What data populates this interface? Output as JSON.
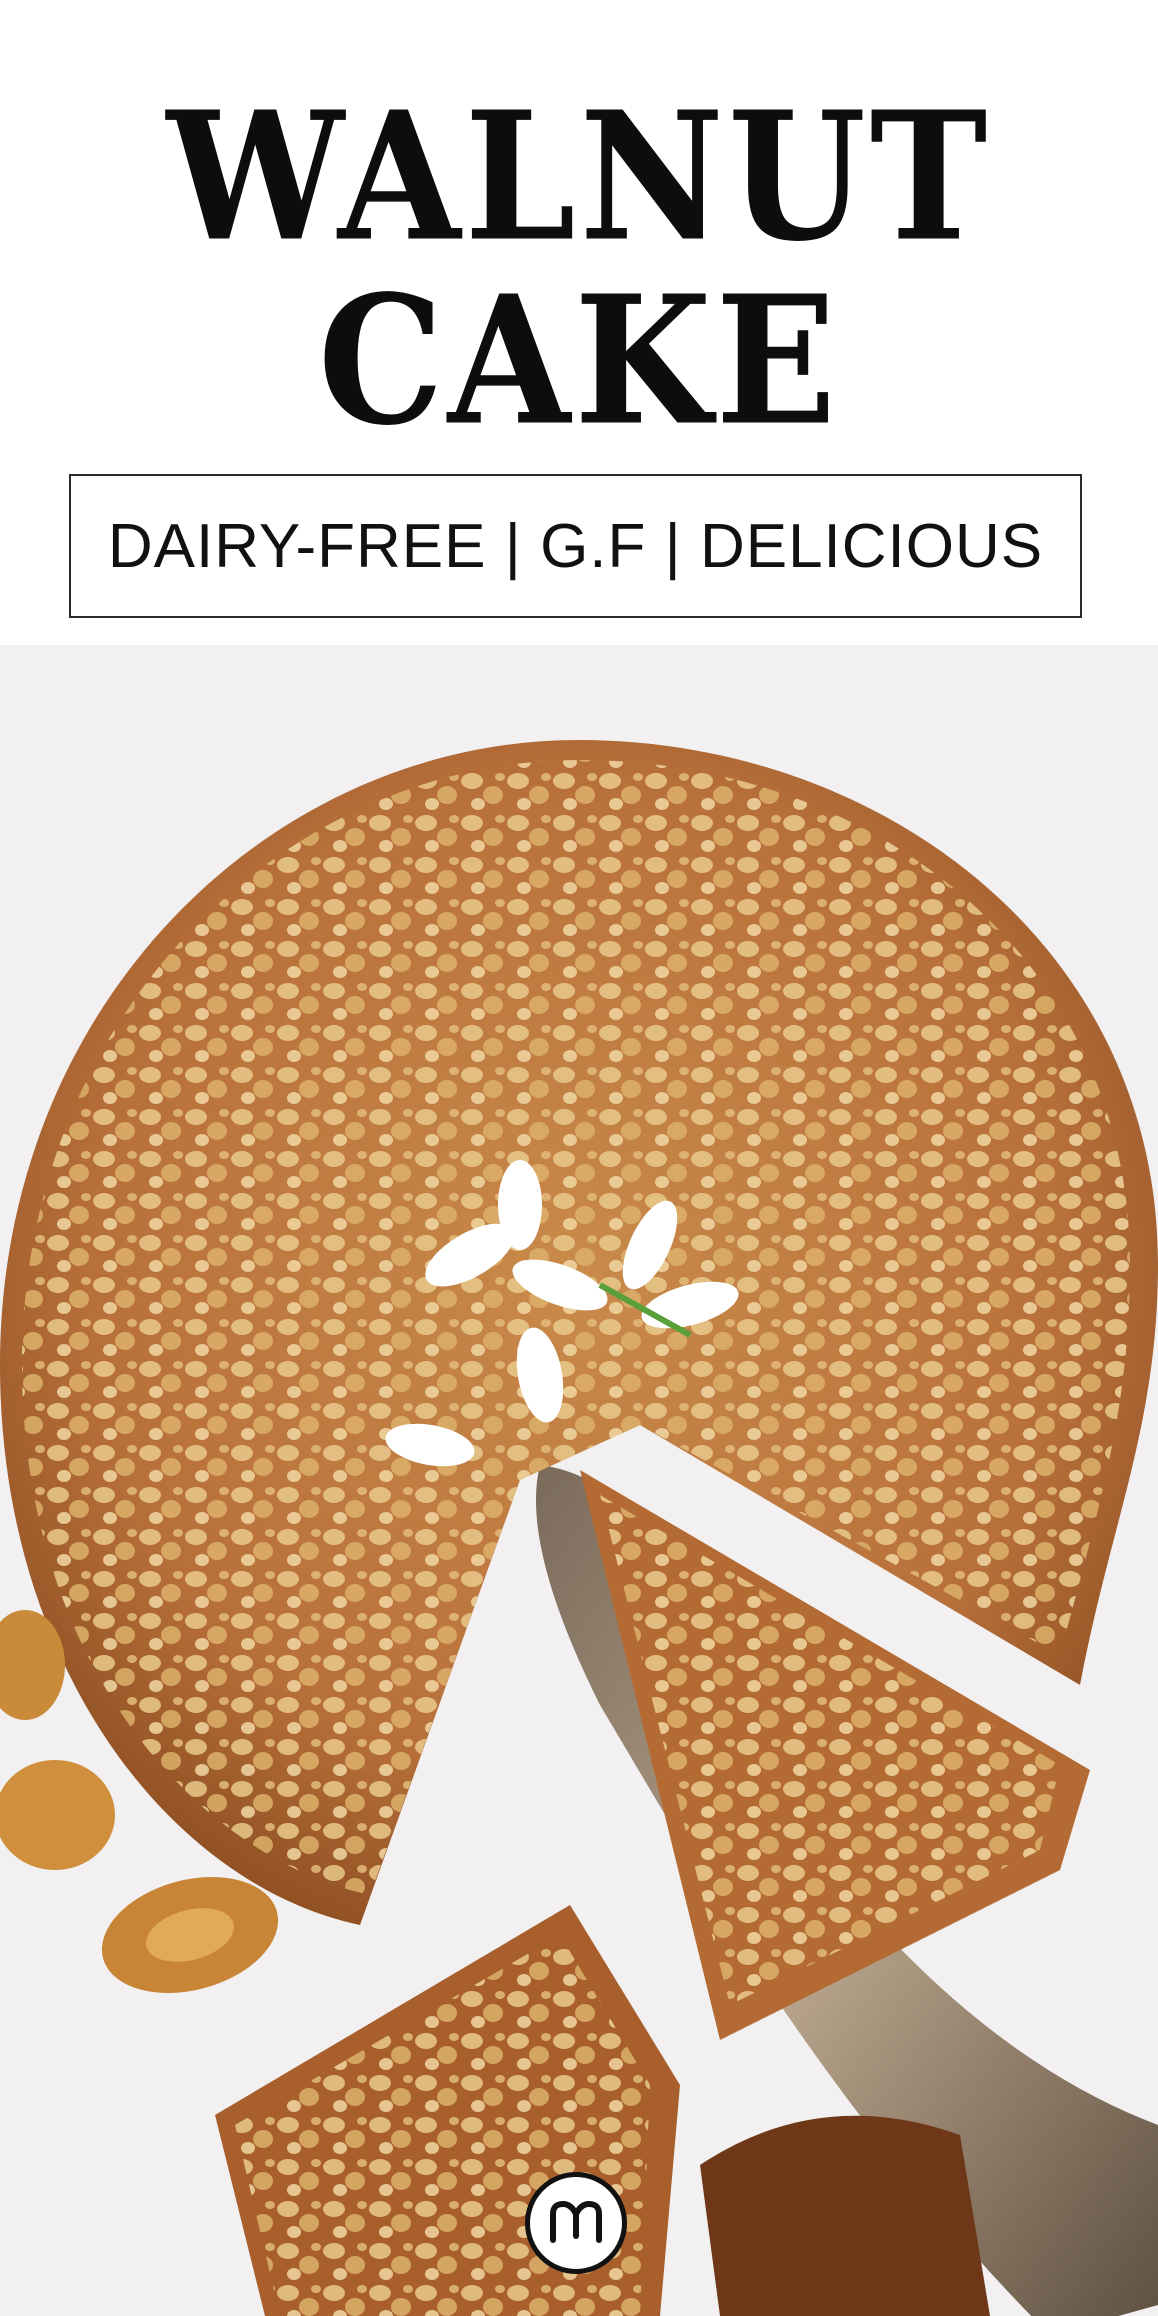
{
  "title": {
    "line1": "WALNUT",
    "line2": "CAKE"
  },
  "tagline": "DAIRY-FREE | G.F | DELICIOUS",
  "photo": {
    "subject": "walnut-cake-photo"
  },
  "logo": {
    "icon": "m-logo-icon"
  }
}
